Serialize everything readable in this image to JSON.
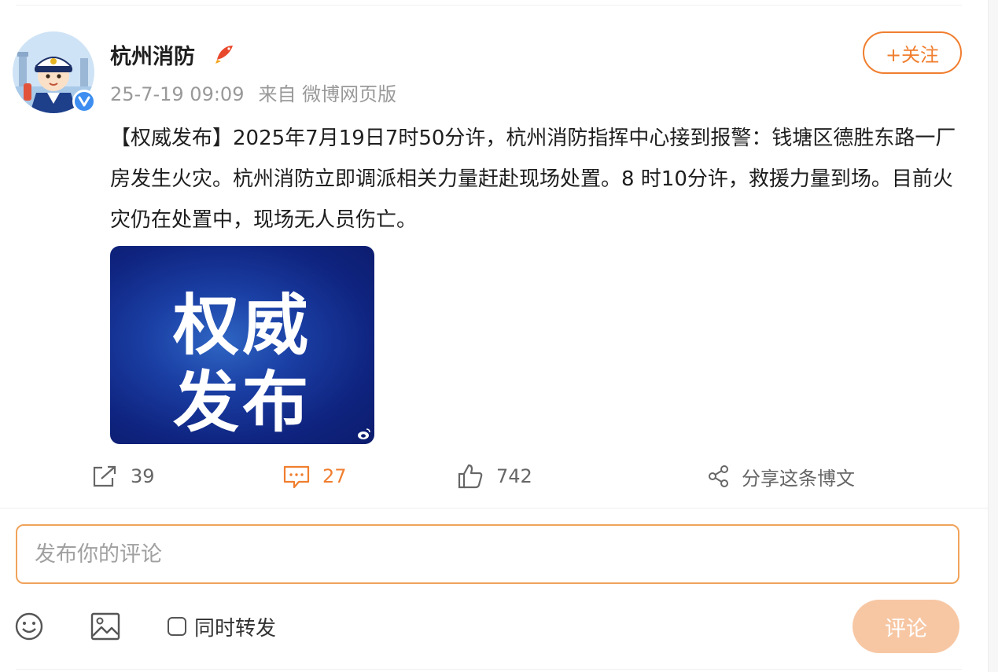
{
  "post": {
    "author": "杭州消防",
    "timestamp": "25-7-19 09:09",
    "source": "来自 微博网页版",
    "follow_label": "+关注",
    "text": "【权威发布】2025年7月19日7时50分许，杭州消防指挥中心接到报警：钱塘区德胜东路一厂房发生火灾。杭州消防立即调派相关力量赶赴现场处置。8 时10分许，救援力量到场。目前火灾仍在处置中，现场无人员伤亡。",
    "image": {
      "line1": "权威",
      "line2": "发布"
    },
    "accent_color": "#f07e2f"
  },
  "actions": {
    "forward_count": "39",
    "comment_count": "27",
    "like_count": "742",
    "share_label": "分享这条博文"
  },
  "composer": {
    "placeholder": "发布你的评论",
    "repost_label": "同时转发",
    "submit_label": "评论"
  },
  "icons": [
    "avatar-firefighter",
    "verified-icon",
    "rank-fish-icon",
    "forward-icon",
    "comment-icon",
    "like-icon",
    "share-icon",
    "emoji-icon",
    "image-icon",
    "weibo-watermark-icon"
  ]
}
